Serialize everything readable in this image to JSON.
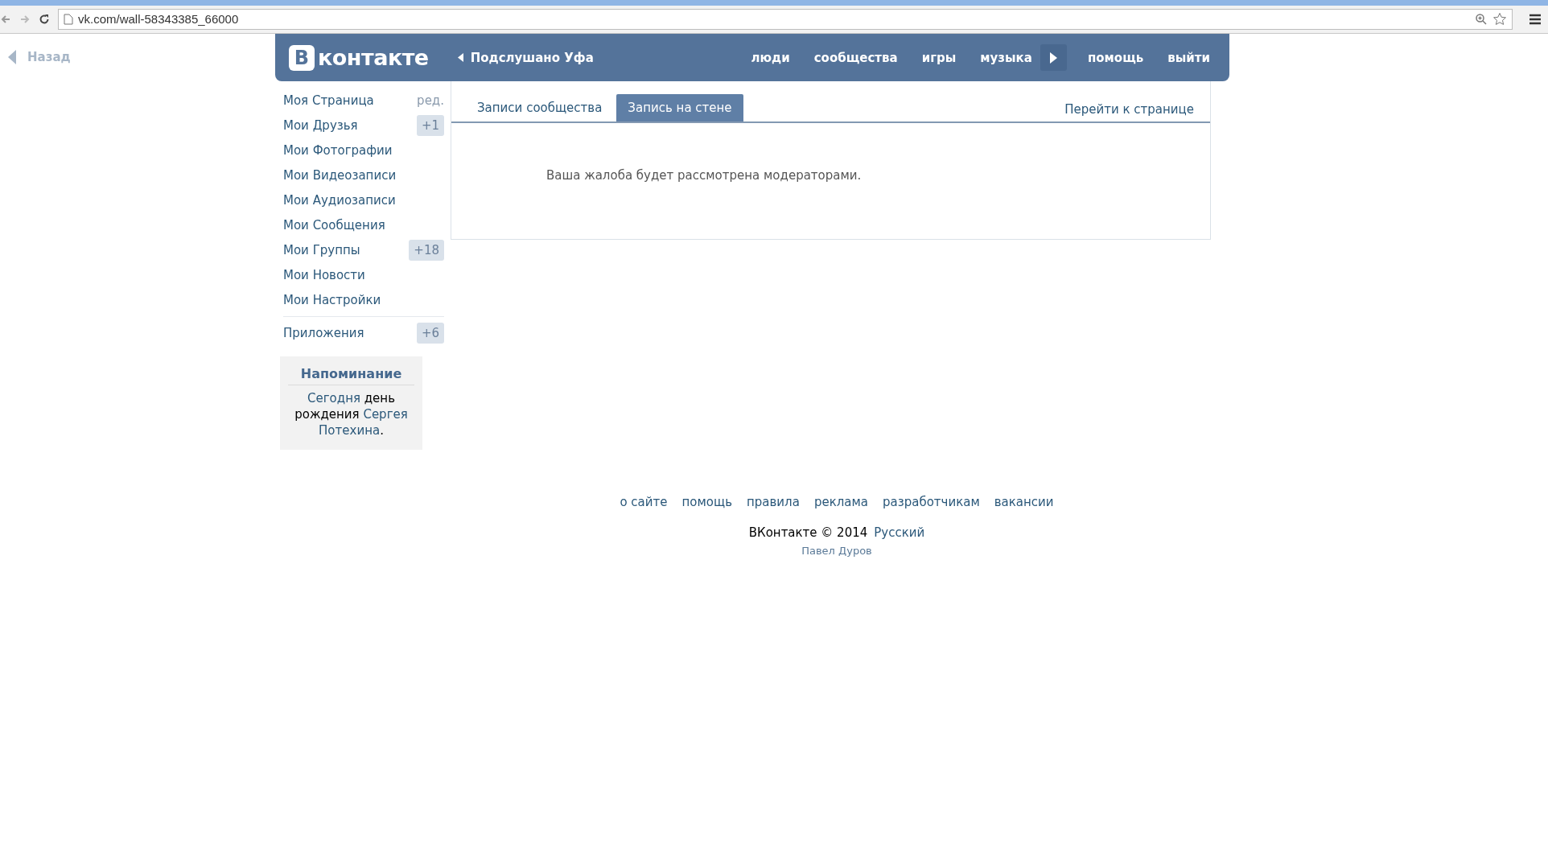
{
  "browser": {
    "url": "vk.com/wall-58343385_66000"
  },
  "back": {
    "label": "Назад"
  },
  "header": {
    "logo_mark": "В",
    "logo_text": "контакте",
    "group_link": "Подслушано Уфа",
    "nav": [
      {
        "label": "люди",
        "kind": "link"
      },
      {
        "label": "сообщества",
        "kind": "link"
      },
      {
        "label": "игры",
        "kind": "link"
      },
      {
        "label": "музыка",
        "kind": "link"
      },
      {
        "kind": "play"
      },
      {
        "label": "помощь",
        "kind": "link"
      },
      {
        "label": "выйти",
        "kind": "link"
      }
    ]
  },
  "sidebar": {
    "edit_link": "ред.",
    "items": [
      {
        "label": "Моя Страница"
      },
      {
        "label": "Мои Друзья",
        "badge": "+1"
      },
      {
        "label": "Мои Фотографии"
      },
      {
        "label": "Мои Видеозаписи"
      },
      {
        "label": "Мои Аудиозаписи"
      },
      {
        "label": "Мои Сообщения"
      },
      {
        "label": "Мои Группы",
        "badge": "+18"
      },
      {
        "label": "Мои Новости"
      },
      {
        "label": "Мои Настройки"
      }
    ],
    "apps": [
      {
        "label": "Приложения",
        "badge": "+6"
      }
    ],
    "reminder": {
      "title": "Напоминание",
      "parts": [
        {
          "text": "Сегодня",
          "kind": "link"
        },
        {
          "text": " день рождения ",
          "kind": "plain"
        },
        {
          "text": "Сергея ",
          "kind": "link"
        },
        {
          "text": "Потехина",
          "kind": "link"
        },
        {
          "text": ".",
          "kind": "plain"
        }
      ]
    }
  },
  "content": {
    "tabs": [
      {
        "label": "Записи сообщества",
        "selected": false
      },
      {
        "label": "Запись на стене",
        "selected": true
      }
    ],
    "page_link": "Перейти к странице",
    "message": "Ваша жалоба будет рассмотрена модераторами."
  },
  "footer": {
    "links": [
      "о сайте",
      "помощь",
      "правила",
      "реклама",
      "разработчикам",
      "вакансии"
    ],
    "copyright": "ВКонтакте © 2014",
    "language": "Русский",
    "author": "Павел Дуров"
  }
}
